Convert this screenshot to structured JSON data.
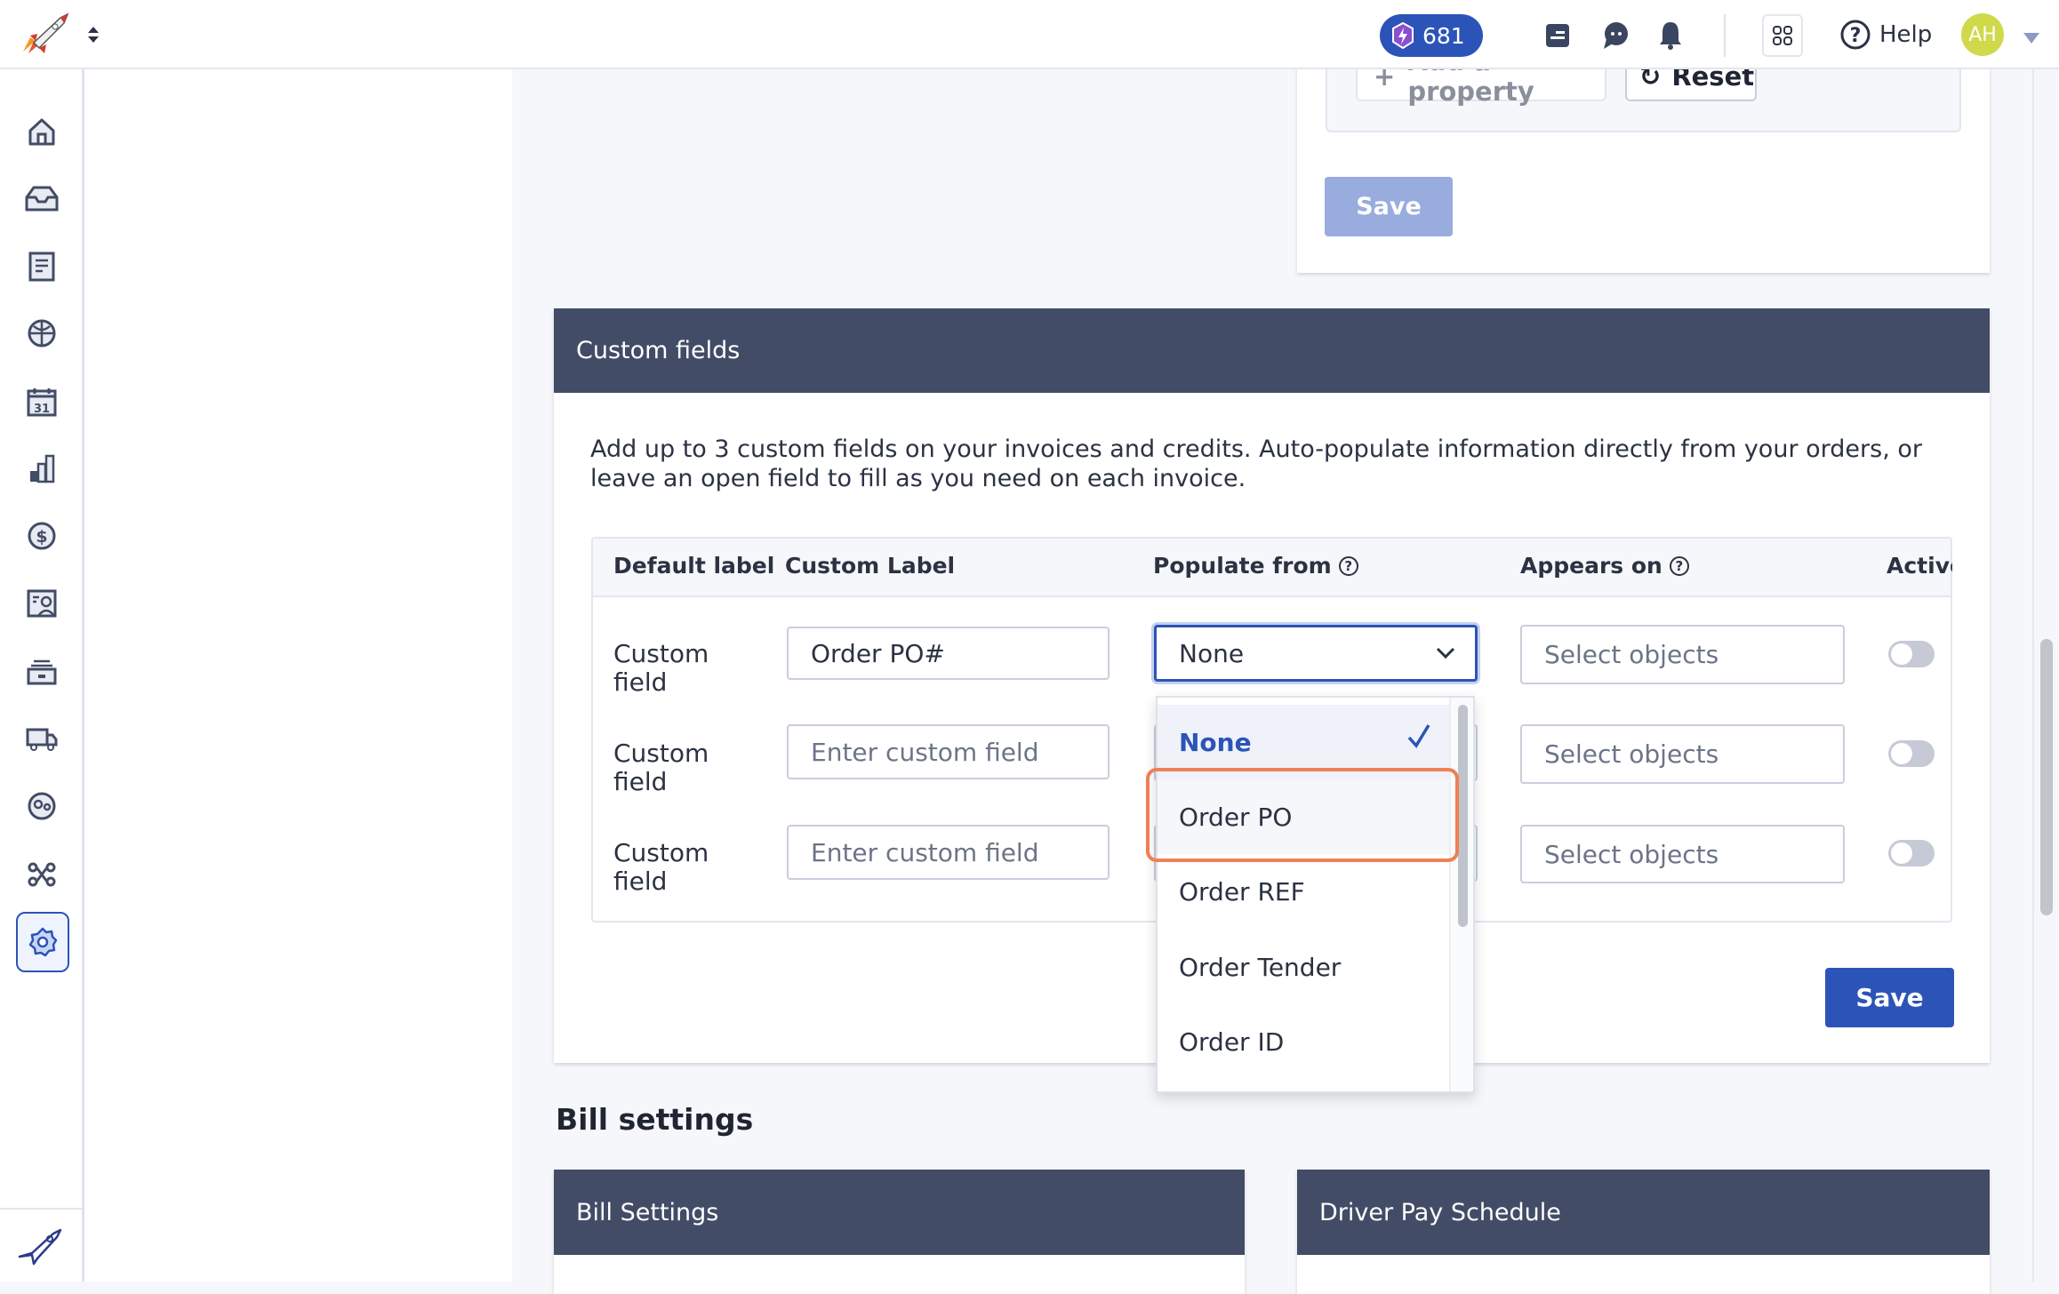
{
  "header": {
    "points": "681",
    "help": "Help",
    "avatar": "AH",
    "accent": "#2c54b8",
    "avatar_color": "#cfd94a"
  },
  "sidebar": {
    "items": [
      "home",
      "inbox",
      "documents",
      "globe",
      "calendar",
      "reports",
      "billing",
      "contacts",
      "storage",
      "trucks",
      "drivers",
      "integrations",
      "settings"
    ],
    "active": "settings",
    "calendar_day": "31"
  },
  "top_card": {
    "add_property": "Add a property",
    "reset": "Reset",
    "save": "Save"
  },
  "custom_fields": {
    "title": "Custom fields",
    "description": "Add up to 3 custom fields on your invoices and credits. Auto-populate information directly from your orders, or leave an open field to fill as you need on each invoice.",
    "columns": [
      "Default label",
      "Custom Label",
      "Populate from",
      "Appears on",
      "Active"
    ],
    "rows": [
      {
        "default_label": "Custom field",
        "custom_label": "Order PO#",
        "custom_placeholder": "Enter custom field",
        "populate_from": "None",
        "appears_on_placeholder": "Select objects",
        "active": false
      },
      {
        "default_label": "Custom field",
        "custom_label": "",
        "custom_placeholder": "Enter custom field",
        "populate_from": "",
        "appears_on_placeholder": "Select objects",
        "active": false
      },
      {
        "default_label": "Custom field",
        "custom_label": "",
        "custom_placeholder": "Enter custom field",
        "populate_from": "",
        "appears_on_placeholder": "Select objects",
        "active": false
      }
    ],
    "dropdown": {
      "options": [
        "None",
        "Order PO",
        "Order REF",
        "Order Tender",
        "Order ID"
      ],
      "selected": "None",
      "highlighted": "Order PO"
    },
    "save": "Save"
  },
  "bill_settings": {
    "heading": "Bill settings",
    "cards": [
      "Bill Settings",
      "Driver Pay Schedule"
    ]
  }
}
